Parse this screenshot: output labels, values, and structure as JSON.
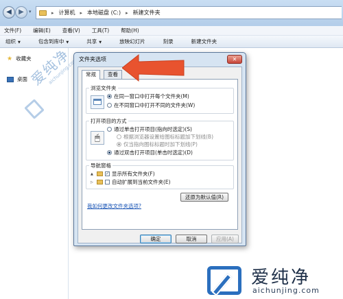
{
  "titlebar": {
    "back_glyph": "◀",
    "forward_glyph": "▶",
    "dropdown_glyph": "▾",
    "separator_glyph": "▸",
    "breadcrumbs": [
      "计算机",
      "本地磁盘 (C:)",
      "新建文件夹"
    ]
  },
  "menubar": {
    "items": [
      "文件(F)",
      "编辑(E)",
      "查看(V)",
      "工具(T)",
      "帮助(H)"
    ]
  },
  "toolbar": {
    "items": [
      "组织",
      "包含到库中",
      "共享",
      "放映幻灯片",
      "刻录",
      "新建文件夹"
    ],
    "arrow_glyph": "▼"
  },
  "sidebar": {
    "favorites": "收藏夹",
    "desktop": "桌面",
    "star_glyph": "★"
  },
  "dialog": {
    "title": "文件夹选项",
    "close_glyph": "✕",
    "tabs": [
      "常规",
      "查看"
    ],
    "browse": {
      "title": "浏览文件夹",
      "opt_same": "在同一窗口中打开每个文件夹(M)",
      "opt_new": "在不同窗口中打开不同的文件夹(W)"
    },
    "click": {
      "title": "打开项目的方式",
      "cursor_glyph": "🖱",
      "opt_single": "通过单击打开项目(指向时选定)(S)",
      "opt_browser": "根据浏览器设置给图标标题加下划线(B)",
      "opt_point": "仅当指向图标标题时加下划线(P)",
      "opt_double": "通过双击打开项目(单击时选定)(D)"
    },
    "nav": {
      "title": "导航窗格",
      "expander_open": "▲",
      "expander_closed": "▷",
      "check_glyph": "✓",
      "show_all": "显示所有文件夹(F)",
      "auto_expand": "自动扩展到当前文件夹(E)"
    },
    "restore_label": "还原为默认值(R)",
    "help_link": "我如何更改文件夹选项?",
    "ok_label": "确定",
    "cancel_label": "取消",
    "apply_label": "应用(A)"
  },
  "watermark": {
    "diag_big": "爱纯净",
    "diag_small": "aichunjing.com",
    "text": "爱纯净",
    "url": "aichunjing.com"
  },
  "colors": {
    "annotation_arrow": "#e8532f",
    "link": "#1a55b5",
    "watermark_blue": "#2b6fbe"
  }
}
